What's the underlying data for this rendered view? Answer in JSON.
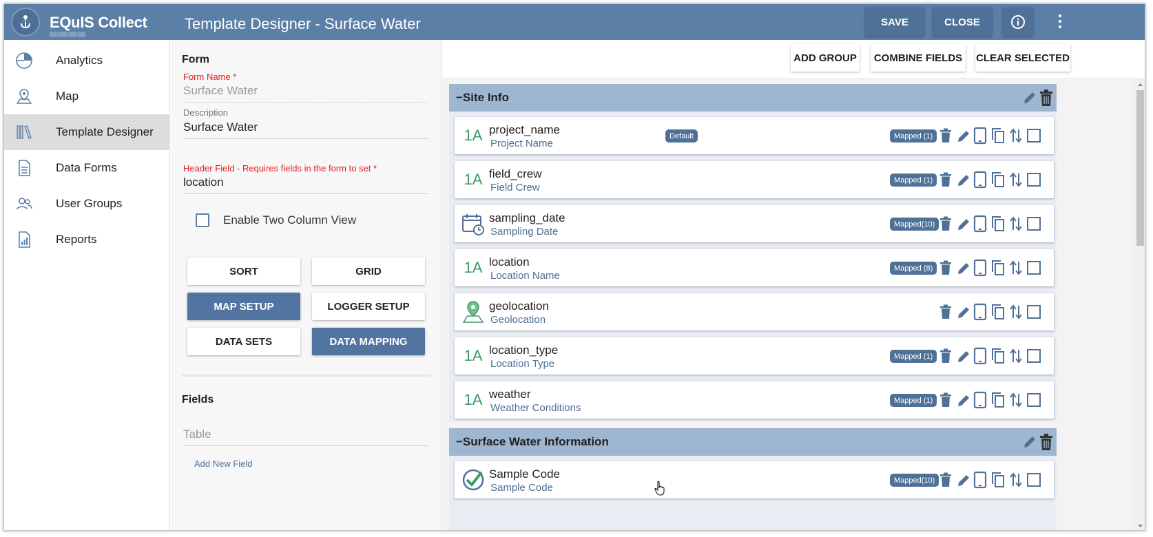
{
  "app": {
    "name": "EQuIS Collect",
    "page_title": "Template Designer - Surface Water"
  },
  "topbar": {
    "save_label": "SAVE",
    "close_label": "CLOSE",
    "info_icon": "info-icon",
    "more_icon": "more-vert-icon"
  },
  "sidebar": {
    "items": [
      {
        "label": "Analytics",
        "icon": "pie-chart-icon"
      },
      {
        "label": "Map",
        "icon": "map-pin-icon"
      },
      {
        "label": "Template Designer",
        "icon": "library-icon",
        "active": true
      },
      {
        "label": "Data Forms",
        "icon": "document-icon"
      },
      {
        "label": "User Groups",
        "icon": "users-icon"
      },
      {
        "label": "Reports",
        "icon": "report-icon"
      }
    ]
  },
  "form": {
    "heading": "Form",
    "form_name_label": "Form Name *",
    "form_name_placeholder": "Surface Water",
    "description_label": "Description",
    "description_value": "Surface Water",
    "header_field_label": "Header Field - Requires fields in the form to set *",
    "header_field_value": "location",
    "two_column_label": "Enable Two Column View",
    "two_column_checked": false,
    "buttons": {
      "sort": "SORT",
      "grid": "GRID",
      "map_setup": "MAP SETUP",
      "logger_setup": "LOGGER SETUP",
      "data_sets": "DATA SETS",
      "data_mapping": "DATA MAPPING"
    },
    "fields_heading": "Fields",
    "table_placeholder": "Table",
    "add_new_field": "Add New Field"
  },
  "actions": {
    "add_group": "ADD GROUP",
    "combine_fields": "COMBINE FIELDS",
    "clear_selected": "CLEAR SELECTED"
  },
  "groups": [
    {
      "title": "−Site Info",
      "fields": [
        {
          "name": "project_name",
          "label": "Project Name",
          "type": "text",
          "type_text": "1A",
          "default_badge": "Default",
          "mapped": "Mapped  (1)"
        },
        {
          "name": "field_crew",
          "label": "Field Crew",
          "type": "text",
          "type_text": "1A",
          "mapped": "Mapped  (1)"
        },
        {
          "name": "sampling_date",
          "label": "Sampling Date",
          "type": "date",
          "mapped": "Mapped(10)"
        },
        {
          "name": "location",
          "label": "Location Name",
          "type": "text",
          "type_text": "1A",
          "mapped": "Mapped  (8)"
        },
        {
          "name": "geolocation",
          "label": "Geolocation",
          "type": "geo"
        },
        {
          "name": "location_type",
          "label": "Location Type",
          "type": "text",
          "type_text": "1A",
          "mapped": "Mapped  (1)"
        },
        {
          "name": "weather",
          "label": "Weather Conditions",
          "type": "text",
          "type_text": "1A",
          "mapped": "Mapped  (1)"
        }
      ]
    },
    {
      "title": "−Surface Water Information",
      "fields": [
        {
          "name": "Sample Code",
          "label": "Sample Code",
          "type": "code",
          "mapped": "Mapped(10)"
        }
      ]
    }
  ],
  "colors": {
    "brand": "#5b7fa6",
    "primary_button": "#5274a0",
    "group_header": "#9fb6d1",
    "required": "#e21d1d",
    "type_icon": "#3d9a6a"
  }
}
